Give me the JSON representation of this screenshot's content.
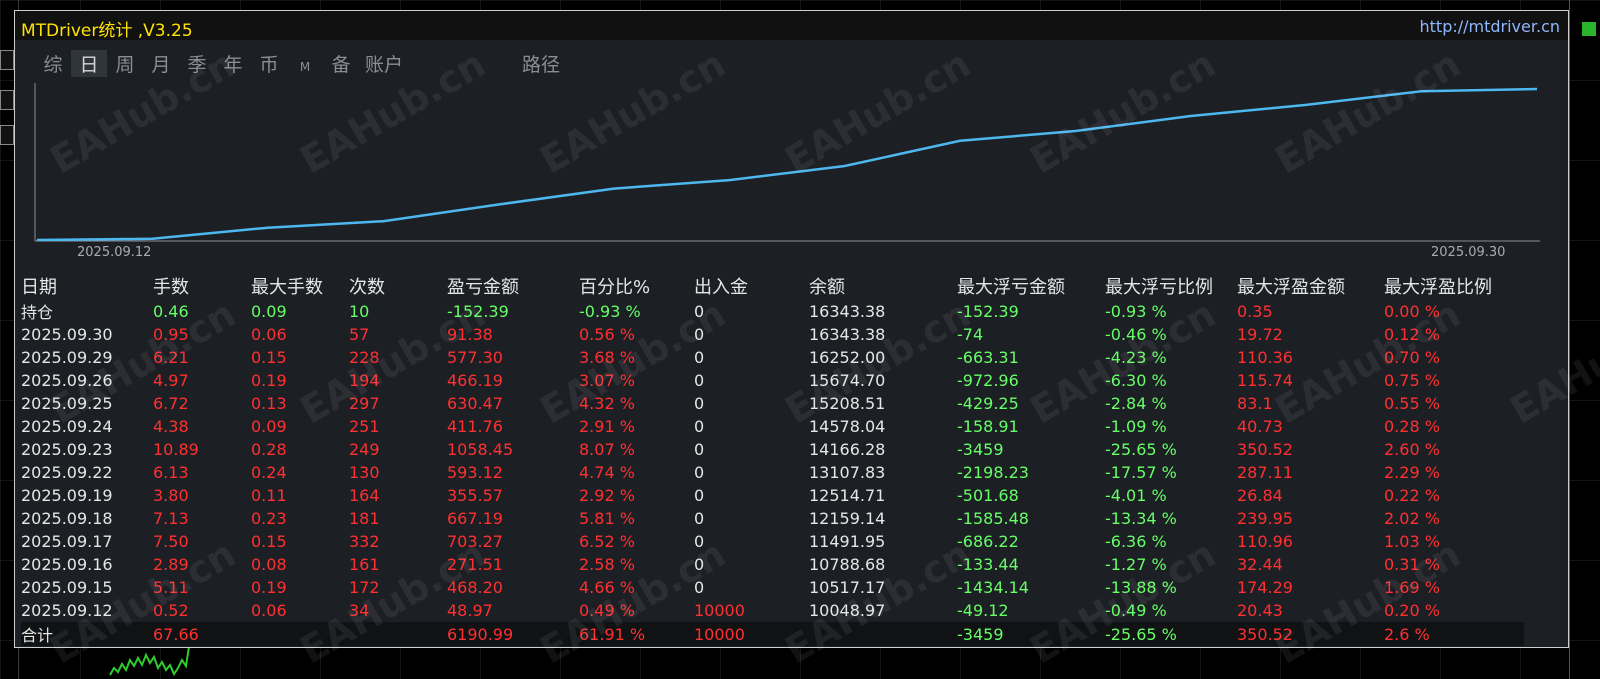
{
  "window": {
    "title": "MTDriver统计 ,V3.25",
    "url": "http://mtdriver.cn"
  },
  "tabs": [
    {
      "label": "综",
      "active": false
    },
    {
      "label": "日",
      "active": true
    },
    {
      "label": "周",
      "active": false
    },
    {
      "label": "月",
      "active": false
    },
    {
      "label": "季",
      "active": false
    },
    {
      "label": "年",
      "active": false
    },
    {
      "label": "币",
      "active": false
    },
    {
      "label": "M",
      "active": false
    },
    {
      "label": "备",
      "active": false
    },
    {
      "label": "账户",
      "active": false
    },
    {
      "label": "路径",
      "active": false
    }
  ],
  "chart_data": {
    "type": "line",
    "x_start_label": "2025.09.12",
    "x_end_label": "2025.09.30",
    "series": [
      {
        "values": [
          10000,
          10048.97,
          10517.17,
          10788.68,
          11491.95,
          12159.14,
          12514.71,
          13107.83,
          14166.28,
          14578.04,
          15208.51,
          15674.7,
          16252.0,
          16343.38
        ],
        "color": "#4db8f0"
      }
    ]
  },
  "watermark": "EAHub.cn",
  "table": {
    "headers": [
      "日期",
      "手数",
      "最大手数",
      "次数",
      "盈亏金额",
      "百分比%",
      "出入金",
      "余额",
      "最大浮亏金额",
      "最大浮亏比例",
      "最大浮盈金额",
      "最大浮盈比例"
    ],
    "position_row": {
      "date": "持仓",
      "lots": "0.46",
      "max_lots": "0.09",
      "count": "10",
      "pl": "-152.39",
      "pct": "-0.93 %",
      "io": "0",
      "balance": "16343.38",
      "mfl": "-152.39",
      "mflp": "-0.93 %",
      "mfp": "0.35",
      "mfpp": "0.00 %"
    },
    "rows": [
      {
        "date": "2025.09.30",
        "lots": "0.95",
        "max_lots": "0.06",
        "count": "57",
        "pl": "91.38",
        "pct": "0.56 %",
        "io": "0",
        "balance": "16343.38",
        "mfl": "-74",
        "mflp": "-0.46 %",
        "mfp": "19.72",
        "mfpp": "0.12 %"
      },
      {
        "date": "2025.09.29",
        "lots": "6.21",
        "max_lots": "0.15",
        "count": "228",
        "pl": "577.30",
        "pct": "3.68 %",
        "io": "0",
        "balance": "16252.00",
        "mfl": "-663.31",
        "mflp": "-4.23 %",
        "mfp": "110.36",
        "mfpp": "0.70 %"
      },
      {
        "date": "2025.09.26",
        "lots": "4.97",
        "max_lots": "0.19",
        "count": "194",
        "pl": "466.19",
        "pct": "3.07 %",
        "io": "0",
        "balance": "15674.70",
        "mfl": "-972.96",
        "mflp": "-6.30 %",
        "mfp": "115.74",
        "mfpp": "0.75 %"
      },
      {
        "date": "2025.09.25",
        "lots": "6.72",
        "max_lots": "0.13",
        "count": "297",
        "pl": "630.47",
        "pct": "4.32 %",
        "io": "0",
        "balance": "15208.51",
        "mfl": "-429.25",
        "mflp": "-2.84 %",
        "mfp": "83.1",
        "mfpp": "0.55 %"
      },
      {
        "date": "2025.09.24",
        "lots": "4.38",
        "max_lots": "0.09",
        "count": "251",
        "pl": "411.76",
        "pct": "2.91 %",
        "io": "0",
        "balance": "14578.04",
        "mfl": "-158.91",
        "mflp": "-1.09 %",
        "mfp": "40.73",
        "mfpp": "0.28 %"
      },
      {
        "date": "2025.09.23",
        "lots": "10.89",
        "max_lots": "0.28",
        "count": "249",
        "pl": "1058.45",
        "pct": "8.07 %",
        "io": "0",
        "balance": "14166.28",
        "mfl": "-3459",
        "mflp": "-25.65 %",
        "mfp": "350.52",
        "mfpp": "2.60 %"
      },
      {
        "date": "2025.09.22",
        "lots": "6.13",
        "max_lots": "0.24",
        "count": "130",
        "pl": "593.12",
        "pct": "4.74 %",
        "io": "0",
        "balance": "13107.83",
        "mfl": "-2198.23",
        "mflp": "-17.57 %",
        "mfp": "287.11",
        "mfpp": "2.29 %"
      },
      {
        "date": "2025.09.19",
        "lots": "3.80",
        "max_lots": "0.11",
        "count": "164",
        "pl": "355.57",
        "pct": "2.92 %",
        "io": "0",
        "balance": "12514.71",
        "mfl": "-501.68",
        "mflp": "-4.01 %",
        "mfp": "26.84",
        "mfpp": "0.22 %"
      },
      {
        "date": "2025.09.18",
        "lots": "7.13",
        "max_lots": "0.23",
        "count": "181",
        "pl": "667.19",
        "pct": "5.81 %",
        "io": "0",
        "balance": "12159.14",
        "mfl": "-1585.48",
        "mflp": "-13.34 %",
        "mfp": "239.95",
        "mfpp": "2.02 %"
      },
      {
        "date": "2025.09.17",
        "lots": "7.50",
        "max_lots": "0.15",
        "count": "332",
        "pl": "703.27",
        "pct": "6.52 %",
        "io": "0",
        "balance": "11491.95",
        "mfl": "-686.22",
        "mflp": "-6.36 %",
        "mfp": "110.96",
        "mfpp": "1.03 %"
      },
      {
        "date": "2025.09.16",
        "lots": "2.89",
        "max_lots": "0.08",
        "count": "161",
        "pl": "271.51",
        "pct": "2.58 %",
        "io": "0",
        "balance": "10788.68",
        "mfl": "-133.44",
        "mflp": "-1.27 %",
        "mfp": "32.44",
        "mfpp": "0.31 %"
      },
      {
        "date": "2025.09.15",
        "lots": "5.11",
        "max_lots": "0.19",
        "count": "172",
        "pl": "468.20",
        "pct": "4.66 %",
        "io": "0",
        "balance": "10517.17",
        "mfl": "-1434.14",
        "mflp": "-13.88 %",
        "mfp": "174.29",
        "mfpp": "1.69 %"
      },
      {
        "date": "2025.09.12",
        "lots": "0.52",
        "max_lots": "0.06",
        "count": "34",
        "pl": "48.97",
        "pct": "0.49 %",
        "io": "10000",
        "balance": "10048.97",
        "mfl": "-49.12",
        "mflp": "-0.49 %",
        "mfp": "20.43",
        "mfpp": "0.20 %"
      }
    ],
    "total_row": {
      "date": "合计",
      "lots": "67.66",
      "max_lots": "",
      "count": "",
      "pl": "6190.99",
      "pct": "61.91 %",
      "io": "10000",
      "balance": "",
      "mfl": "-3459",
      "mflp": "-25.65 %",
      "mfp": "350.52",
      "mfpp": "2.6 %"
    }
  }
}
